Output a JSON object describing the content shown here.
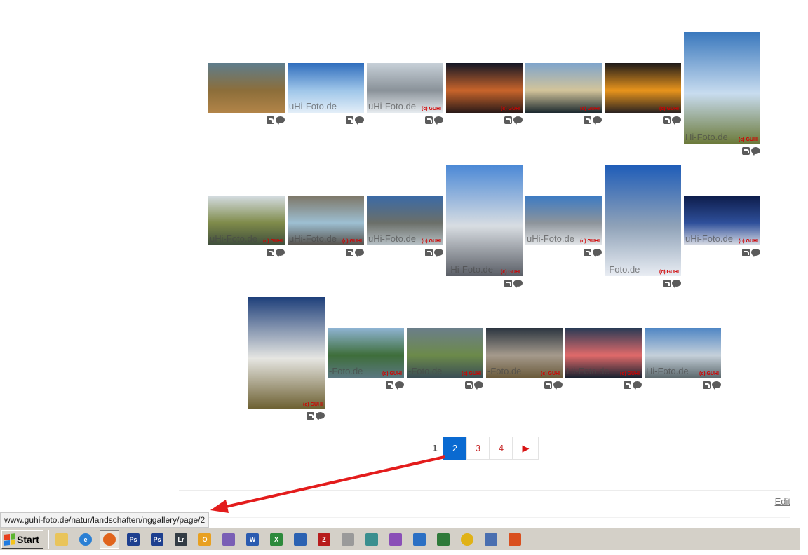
{
  "gallery": {
    "rows": [
      [
        {
          "orient": "land",
          "colors": [
            "#5e7d8c",
            "#8c6e3a",
            "#b28448"
          ],
          "watermark": "",
          "copyright": ""
        },
        {
          "orient": "land",
          "colors": [
            "#2f6dbd",
            "#9fc6e9",
            "#e3eef8"
          ],
          "watermark": "uHi-Foto.de",
          "copyright": ""
        },
        {
          "orient": "land",
          "colors": [
            "#c7d0d8",
            "#8a9299",
            "#e6ebef"
          ],
          "watermark": "uHi-Foto.de",
          "copyright": "(c) GUHI"
        },
        {
          "orient": "land",
          "colors": [
            "#121625",
            "#c8642b",
            "#2b1a18"
          ],
          "watermark": "",
          "copyright": "(c) GUHI"
        },
        {
          "orient": "land",
          "colors": [
            "#7ea4cc",
            "#d3c49a",
            "#1c2a2f"
          ],
          "watermark": "",
          "copyright": "(c) GUHI"
        },
        {
          "orient": "land",
          "colors": [
            "#1d1a1a",
            "#e8941c",
            "#2b2320"
          ],
          "watermark": "",
          "copyright": "(c) GUHI"
        },
        {
          "orient": "port",
          "colors": [
            "#3a78bd",
            "#c8dcef",
            "#6c7a3a"
          ],
          "watermark": "Hi-Foto.de",
          "copyright": "(c) GUHI"
        }
      ],
      [
        {
          "orient": "land",
          "colors": [
            "#d5dde3",
            "#7f8b4a",
            "#3e4d3c"
          ],
          "watermark": "uHi-Foto.de",
          "copyright": "(c) GUHI"
        },
        {
          "orient": "land",
          "colors": [
            "#7d7667",
            "#9dbfd2",
            "#55504a"
          ],
          "watermark": "uHi-Foto.de",
          "copyright": "(c) GUHI"
        },
        {
          "orient": "land",
          "colors": [
            "#3a6aa7",
            "#6b6f69",
            "#b7c1c6"
          ],
          "watermark": "uHi-Foto.de",
          "copyright": "(c) GUHI"
        },
        {
          "orient": "port",
          "colors": [
            "#4a88d6",
            "#d8dde2",
            "#5a5e66"
          ],
          "watermark": "-Hi-Foto.de",
          "copyright": "(c) GUHI"
        },
        {
          "orient": "land",
          "colors": [
            "#3b7ac4",
            "#8d949b",
            "#e4e7ea"
          ],
          "watermark": "uHi-Foto.de",
          "copyright": "(c) GUHI"
        },
        {
          "orient": "port",
          "colors": [
            "#1e5cb8",
            "#8fa2b8",
            "#e9edf3"
          ],
          "watermark": "-Foto.de",
          "copyright": "(c) GUHI"
        },
        {
          "orient": "land",
          "colors": [
            "#0d1c4a",
            "#2e4f9a",
            "#d9dce4"
          ],
          "watermark": "uHi-Foto.de",
          "copyright": "(c) GUHI"
        }
      ],
      [
        {
          "orient": "port",
          "colors": [
            "#1e3f7a",
            "#e6e6e2",
            "#6e6133"
          ],
          "watermark": "",
          "copyright": "(c) GUHI"
        },
        {
          "orient": "land",
          "colors": [
            "#8fb4d4",
            "#3e6e3a",
            "#5a7780"
          ],
          "watermark": "-Foto.de",
          "copyright": "(c) GUHI"
        },
        {
          "orient": "land",
          "colors": [
            "#6b7e8a",
            "#6c8a4a",
            "#3a4e55"
          ],
          "watermark": "-Foto.de",
          "copyright": "(c) GUHI"
        },
        {
          "orient": "land",
          "colors": [
            "#2b3540",
            "#a59a8c",
            "#6a5a3a"
          ],
          "watermark": "-Foto.de",
          "copyright": "(c) GUHI"
        },
        {
          "orient": "land",
          "colors": [
            "#283a55",
            "#e06a6a",
            "#1a2230"
          ],
          "watermark": "Hi-Foto.de",
          "copyright": "(c) GUHI"
        },
        {
          "orient": "land",
          "colors": [
            "#4f86c4",
            "#c5d0da",
            "#5d6a6e"
          ],
          "watermark": "Hi-Foto.de",
          "copyright": "(c) GUHI"
        }
      ]
    ]
  },
  "pagination": {
    "current_plain": "1",
    "active": "2",
    "links": [
      "3",
      "4"
    ],
    "next_symbol": "▶"
  },
  "footer": {
    "edit_label": "Edit"
  },
  "status_bar": {
    "url": "www.guhi-foto.de/natur/landschaften/nggallery/page/2"
  },
  "taskbar": {
    "start_label": "Start",
    "icons": [
      {
        "name": "show-desktop-icon",
        "label": "",
        "color": "#e9c45a"
      },
      {
        "name": "internet-explorer-icon",
        "label": "e",
        "color": "#2a7fd4",
        "round": true
      },
      {
        "name": "firefox-icon",
        "label": "",
        "color": "#e0641c",
        "round": true,
        "pressed": true
      },
      {
        "name": "photoshop-icon",
        "label": "Ps",
        "color": "#1d3f8f"
      },
      {
        "name": "photoshop-2-icon",
        "label": "Ps",
        "color": "#1d3f8f"
      },
      {
        "name": "lightroom-icon",
        "label": "Lr",
        "color": "#333c44"
      },
      {
        "name": "outlook-icon",
        "label": "O",
        "color": "#e8a020"
      },
      {
        "name": "onenote-icon",
        "label": "",
        "color": "#7a5fb5"
      },
      {
        "name": "word-icon",
        "label": "W",
        "color": "#2a5bb0"
      },
      {
        "name": "excel-icon",
        "label": "X",
        "color": "#2d8a3c"
      },
      {
        "name": "app-window-icon",
        "label": "",
        "color": "#2b62b2"
      },
      {
        "name": "filezilla-icon",
        "label": "Z",
        "color": "#b71c1c"
      },
      {
        "name": "media-icon",
        "label": "",
        "color": "#9a9a9a"
      },
      {
        "name": "network-icon",
        "label": "",
        "color": "#3a8f8f"
      },
      {
        "name": "paint-icon",
        "label": "",
        "color": "#8a4fb7"
      },
      {
        "name": "image-viewer-icon",
        "label": "",
        "color": "#2b70c4"
      },
      {
        "name": "chart-app-icon",
        "label": "",
        "color": "#2f7a3a"
      },
      {
        "name": "norton-icon",
        "label": "",
        "color": "#e0b216",
        "round": true
      },
      {
        "name": "network-connection-icon",
        "label": "",
        "color": "#4a6fb0"
      },
      {
        "name": "grid-app-icon",
        "label": "",
        "color": "#d94f1e"
      }
    ]
  },
  "annotation": {
    "arrow_color": "#e31c1c"
  }
}
